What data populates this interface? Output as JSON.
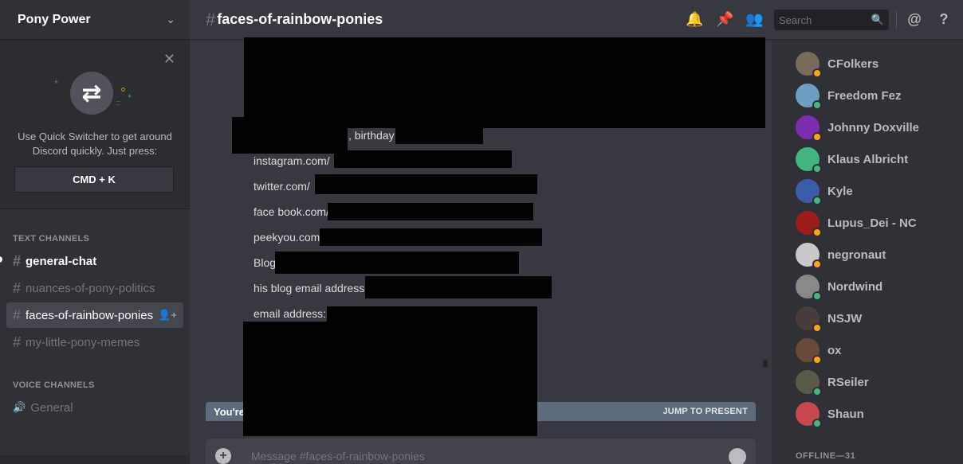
{
  "sidebar": {
    "server_name": "Pony Power",
    "quick_switcher": {
      "text": "Use Quick Switcher to get around Discord quickly. Just press:",
      "key": "CMD + K"
    },
    "text_category": "TEXT CHANNELS",
    "text_channels": [
      {
        "label": "general-chat",
        "state": "unread"
      },
      {
        "label": "nuances-of-pony-politics",
        "state": "muted"
      },
      {
        "label": "faces-of-rainbow-ponies",
        "state": "active"
      },
      {
        "label": "my-little-pony-memes",
        "state": "muted"
      }
    ],
    "voice_category": "VOICE CHANNELS",
    "voice_channels": [
      {
        "label": "General"
      }
    ]
  },
  "header": {
    "channel_name": "faces-of-rainbow-ponies",
    "search_placeholder": "Search",
    "icons": [
      "bell-icon",
      "pin-icon",
      "members-icon",
      "at-icon",
      "help-icon"
    ]
  },
  "messages": {
    "lines": [
      ", birthday",
      "instagram.com/",
      "twitter.com/",
      "face book.com/",
      "peekyou.com",
      "Blog",
      "his blog email address:",
      "email address:"
    ]
  },
  "jump_bar": {
    "left_text": "You're",
    "right_text": "JUMP TO PRESENT"
  },
  "composer": {
    "placeholder": "Message #faces-of-rainbow-ponies"
  },
  "members": {
    "online": [
      {
        "name": "CFolkers",
        "status": "idle",
        "color": "#7a6a5a"
      },
      {
        "name": "Freedom Fez",
        "status": "online",
        "color": "#6f9fbf"
      },
      {
        "name": "Johnny Doxville",
        "status": "idle",
        "color": "#7b2fb0"
      },
      {
        "name": "Klaus Albricht",
        "status": "online",
        "color": "#43b581"
      },
      {
        "name": "Kyle",
        "status": "online",
        "color": "#3c5ba8"
      },
      {
        "name": "Lupus_Dei - NC",
        "status": "idle",
        "color": "#9c1b1b"
      },
      {
        "name": "negronaut",
        "status": "idle",
        "color": "#c9c9c9"
      },
      {
        "name": "Nordwind",
        "status": "online",
        "color": "#888888"
      },
      {
        "name": "NSJW",
        "status": "idle",
        "color": "#4a3d3d"
      },
      {
        "name": "ox",
        "status": "idle",
        "color": "#6b4a3a"
      },
      {
        "name": "RSeiler",
        "status": "online",
        "color": "#5a5a4a"
      },
      {
        "name": "Shaun",
        "status": "online",
        "color": "#c8484d"
      }
    ],
    "offline_header": "OFFLINE—31"
  },
  "colors": {
    "online": "#43b581",
    "idle": "#faa61a"
  }
}
